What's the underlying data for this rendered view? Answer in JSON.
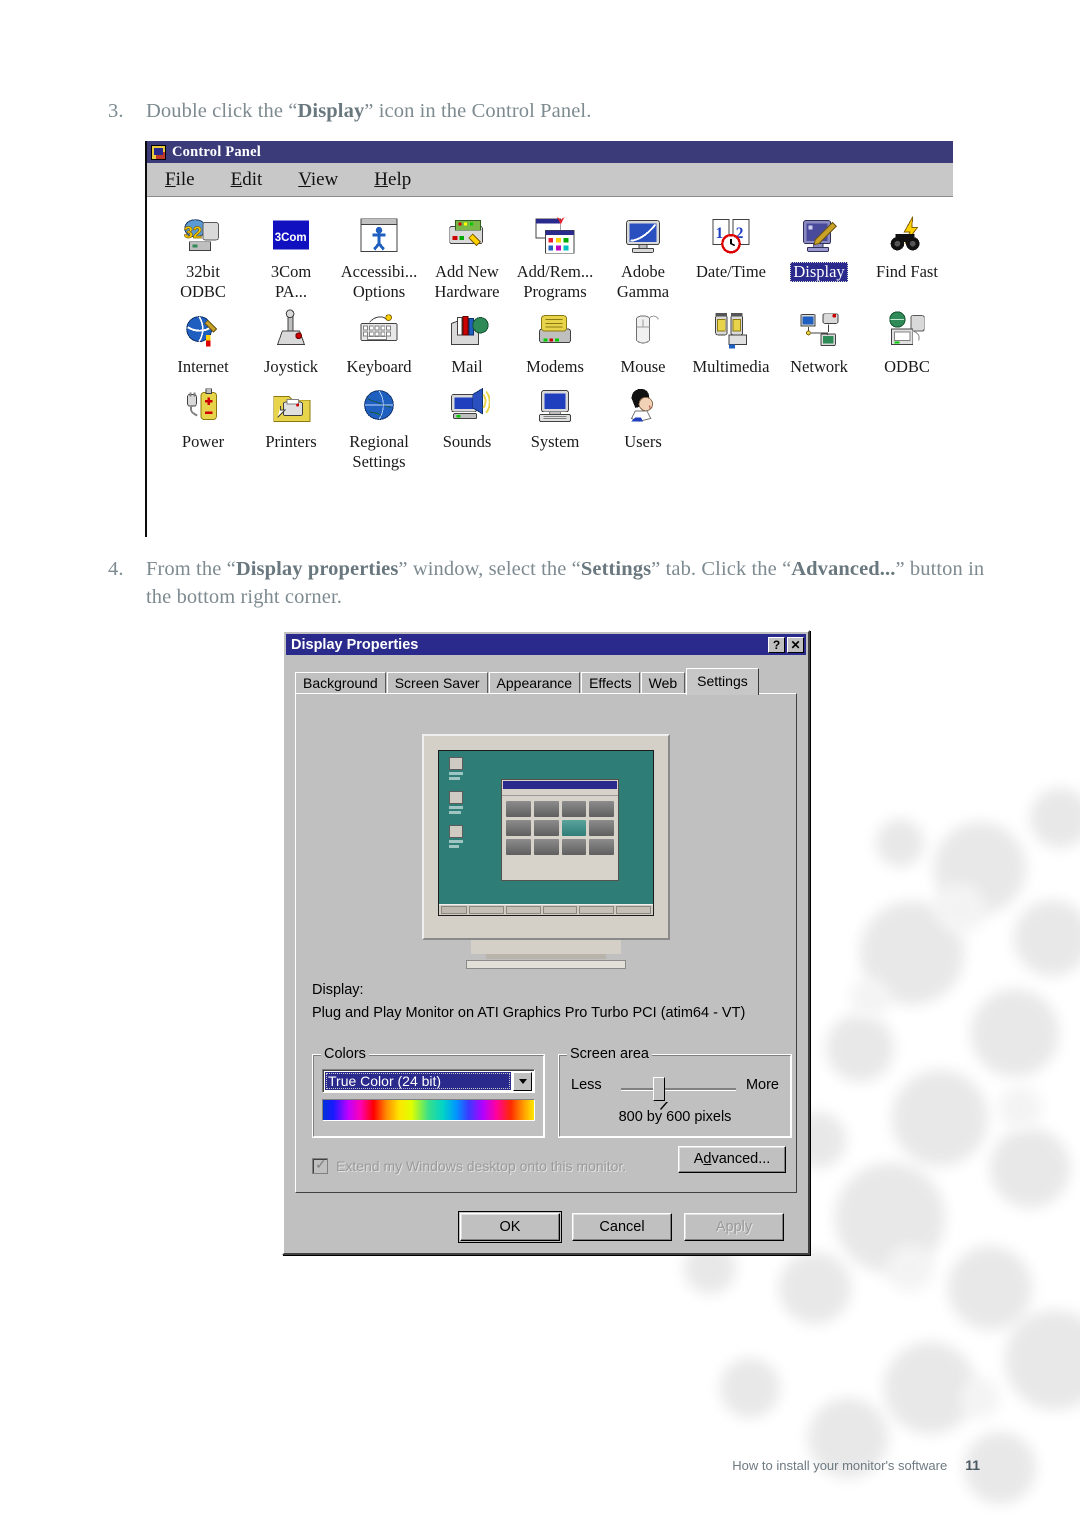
{
  "steps": [
    {
      "number": "3.",
      "segments": [
        {
          "t": "Double click the “",
          "b": false
        },
        {
          "t": "Display",
          "b": true
        },
        {
          "t": "” icon in the Control Panel.",
          "b": false
        }
      ]
    },
    {
      "number": "4.",
      "segments": [
        {
          "t": "From the “",
          "b": false
        },
        {
          "t": "Display properties",
          "b": true
        },
        {
          "t": "” window, select the “",
          "b": false
        },
        {
          "t": "Settings",
          "b": true
        },
        {
          "t": "” tab. Click the “",
          "b": false
        },
        {
          "t": "Advanced...",
          "b": true
        },
        {
          "t": "” button in the bottom right corner.",
          "b": false
        }
      ]
    }
  ],
  "control_panel": {
    "title": "Control Panel",
    "app_icon": "control-panel-icon",
    "menus": [
      {
        "accel": "F",
        "rest": "ile"
      },
      {
        "accel": "E",
        "rest": "dit"
      },
      {
        "accel": "V",
        "rest": "iew"
      },
      {
        "accel": "H",
        "rest": "elp"
      }
    ],
    "icons": [
      {
        "name": "32bit ODBC",
        "lines": [
          "32bit",
          "ODBC"
        ],
        "icon": "odbc-32bit-icon",
        "selected": false
      },
      {
        "name": "3Com PA...",
        "lines": [
          "3Com",
          "PA..."
        ],
        "icon": "3com-icon",
        "selected": false
      },
      {
        "name": "Accessibility Options",
        "lines": [
          "Accessibi...",
          "Options"
        ],
        "icon": "accessibility-icon",
        "selected": false
      },
      {
        "name": "Add New Hardware",
        "lines": [
          "Add New",
          "Hardware"
        ],
        "icon": "add-new-hardware-icon",
        "selected": false
      },
      {
        "name": "Add/Remove Programs",
        "lines": [
          "Add/Rem...",
          "Programs"
        ],
        "icon": "add-remove-programs-icon",
        "selected": false
      },
      {
        "name": "Adobe Gamma",
        "lines": [
          "Adobe",
          "Gamma"
        ],
        "icon": "adobe-gamma-icon",
        "selected": false
      },
      {
        "name": "Date/Time",
        "lines": [
          "Date/Time"
        ],
        "icon": "date-time-icon",
        "selected": false
      },
      {
        "name": "Display",
        "lines": [
          "Display"
        ],
        "icon": "display-icon",
        "selected": true
      },
      {
        "name": "Find Fast",
        "lines": [
          "Find Fast"
        ],
        "icon": "find-fast-icon",
        "selected": false
      },
      {
        "name": "Internet",
        "lines": [
          "Internet"
        ],
        "icon": "internet-icon",
        "selected": false
      },
      {
        "name": "Joystick",
        "lines": [
          "Joystick"
        ],
        "icon": "joystick-icon",
        "selected": false
      },
      {
        "name": "Keyboard",
        "lines": [
          "Keyboard"
        ],
        "icon": "keyboard-icon",
        "selected": false
      },
      {
        "name": "Mail",
        "lines": [
          "Mail"
        ],
        "icon": "mail-icon",
        "selected": false
      },
      {
        "name": "Modems",
        "lines": [
          "Modems"
        ],
        "icon": "modems-icon",
        "selected": false
      },
      {
        "name": "Mouse",
        "lines": [
          "Mouse"
        ],
        "icon": "mouse-icon",
        "selected": false
      },
      {
        "name": "Multimedia",
        "lines": [
          "Multimedia"
        ],
        "icon": "multimedia-icon",
        "selected": false
      },
      {
        "name": "Network",
        "lines": [
          "Network"
        ],
        "icon": "network-icon",
        "selected": false
      },
      {
        "name": "ODBC",
        "lines": [
          "ODBC"
        ],
        "icon": "odbc-icon",
        "selected": false
      },
      {
        "name": "Power",
        "lines": [
          "Power"
        ],
        "icon": "power-icon",
        "selected": false
      },
      {
        "name": "Printers",
        "lines": [
          "Printers"
        ],
        "icon": "printers-icon",
        "selected": false
      },
      {
        "name": "Regional Settings",
        "lines": [
          "Regional",
          "Settings"
        ],
        "icon": "regional-settings-icon",
        "selected": false
      },
      {
        "name": "Sounds",
        "lines": [
          "Sounds"
        ],
        "icon": "sounds-icon",
        "selected": false
      },
      {
        "name": "System",
        "lines": [
          "System"
        ],
        "icon": "system-icon",
        "selected": false
      },
      {
        "name": "Users",
        "lines": [
          "Users"
        ],
        "icon": "users-icon",
        "selected": false
      }
    ]
  },
  "display_properties": {
    "title": "Display Properties",
    "titlebar_buttons": [
      {
        "label": "?",
        "name": "help-button"
      },
      {
        "label": "✕",
        "name": "close-button"
      }
    ],
    "tabs": [
      {
        "label": "Background",
        "active": false
      },
      {
        "label": "Screen Saver",
        "active": false
      },
      {
        "label": "Appearance",
        "active": false
      },
      {
        "label": "Effects",
        "active": false
      },
      {
        "label": "Web",
        "active": false
      },
      {
        "label": "Settings",
        "active": true
      }
    ],
    "display_label": "Display:",
    "display_value": "Plug and Play Monitor on ATI Graphics Pro Turbo PCI (atim64 - VT)",
    "colors": {
      "group_title": "Colors",
      "selected": "True Color (24 bit)"
    },
    "screen_area": {
      "group_title": "Screen area",
      "less_label": "Less",
      "more_label": "More",
      "resolution": "800 by 600 pixels",
      "slider_percent": 33
    },
    "extend_checkbox": {
      "label": "Extend my Windows desktop onto this monitor.",
      "checked": true,
      "enabled": false
    },
    "advanced_button": {
      "accel": "A",
      "pre": "",
      "mid": "d",
      "label": "Advanced..."
    },
    "footer_buttons": [
      {
        "label": "OK",
        "state": "default"
      },
      {
        "label": "Cancel",
        "state": "normal"
      },
      {
        "label": "Apply",
        "state": "disabled"
      }
    ]
  },
  "page_footer": {
    "text": "How to install your monitor's software",
    "page": "11"
  },
  "colors": {
    "titlebar_cp": "#3b3b7a",
    "titlebar_dp": "#2a2a8c",
    "dialog_face": "#c0c0c0",
    "selection": "#2a2a8c",
    "body_text": "#7d8a90",
    "monitor_desktop": "#2f7d77"
  }
}
